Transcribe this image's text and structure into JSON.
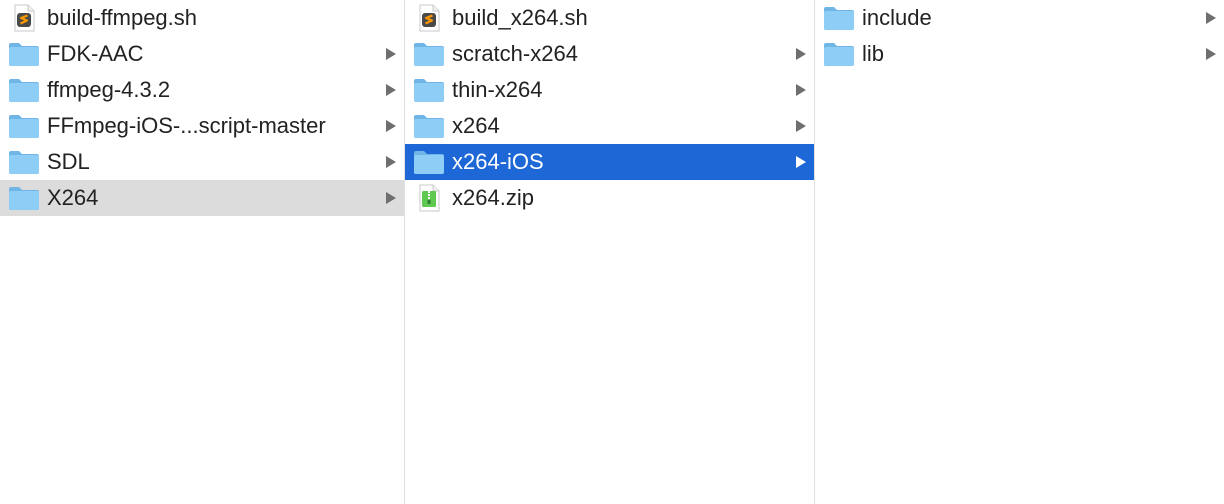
{
  "columns": [
    {
      "items": [
        {
          "label": "build-ffmpeg.sh",
          "icon": "sublime-script-icon",
          "has_children": false,
          "state": "normal"
        },
        {
          "label": "FDK-AAC",
          "icon": "folder-icon",
          "has_children": true,
          "state": "normal"
        },
        {
          "label": "ffmpeg-4.3.2",
          "icon": "folder-icon",
          "has_children": true,
          "state": "normal"
        },
        {
          "label": "FFmpeg-iOS-...script-master",
          "icon": "folder-icon",
          "has_children": true,
          "state": "normal"
        },
        {
          "label": "SDL",
          "icon": "folder-icon",
          "has_children": true,
          "state": "normal"
        },
        {
          "label": "X264",
          "icon": "folder-icon",
          "has_children": true,
          "state": "selected-inactive"
        }
      ]
    },
    {
      "items": [
        {
          "label": "build_x264.sh",
          "icon": "sublime-script-icon",
          "has_children": false,
          "state": "normal"
        },
        {
          "label": "scratch-x264",
          "icon": "folder-icon",
          "has_children": true,
          "state": "normal"
        },
        {
          "label": "thin-x264",
          "icon": "folder-icon",
          "has_children": true,
          "state": "normal"
        },
        {
          "label": "x264",
          "icon": "folder-icon",
          "has_children": true,
          "state": "normal"
        },
        {
          "label": "x264-iOS",
          "icon": "folder-icon",
          "has_children": true,
          "state": "selected-active"
        },
        {
          "label": "x264.zip",
          "icon": "zip-archive-icon",
          "has_children": false,
          "state": "normal"
        }
      ]
    },
    {
      "items": [
        {
          "label": "include",
          "icon": "folder-icon",
          "has_children": true,
          "state": "normal"
        },
        {
          "label": "lib",
          "icon": "folder-icon",
          "has_children": true,
          "state": "normal"
        }
      ]
    }
  ],
  "colors": {
    "selection_active": "#1d67d6",
    "selection_inactive": "#dcdcdc",
    "folder_body": "#8ecdf5",
    "folder_tab": "#6fb6e6",
    "chevron": "#6e6e6e"
  }
}
